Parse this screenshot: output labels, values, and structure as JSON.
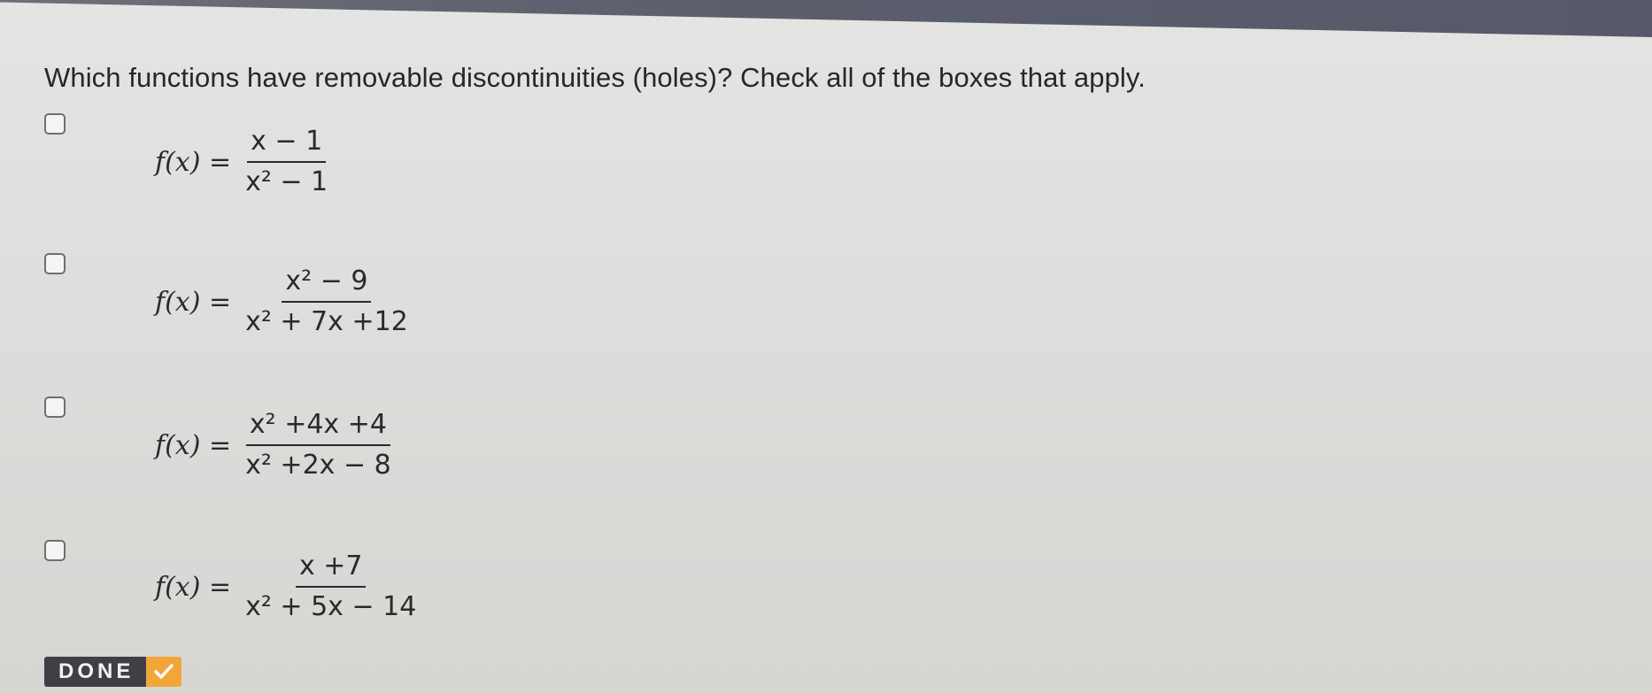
{
  "question": {
    "text": "Which functions have removable discontinuities (holes)? Check all of the boxes that apply."
  },
  "options": [
    {
      "checked": false,
      "lhs": "f(x) =",
      "numerator": "x − 1",
      "denominator": "x² − 1"
    },
    {
      "checked": false,
      "lhs": "f(x) =",
      "numerator": "x² − 9",
      "denominator": "x² + 7x +12"
    },
    {
      "checked": false,
      "lhs": "f(x) =",
      "numerator": "x² +4x +4",
      "denominator": "x² +2x − 8"
    },
    {
      "checked": false,
      "lhs": "f(x) =",
      "numerator": "x +7",
      "denominator": "x² + 5x − 14"
    }
  ],
  "done_button": {
    "label": "DONE",
    "icon": "checkmark-icon"
  },
  "colors": {
    "top_bar": "#5b5e6b",
    "done_background": "#3f3f46",
    "done_check_accent": "#f2a63a"
  }
}
